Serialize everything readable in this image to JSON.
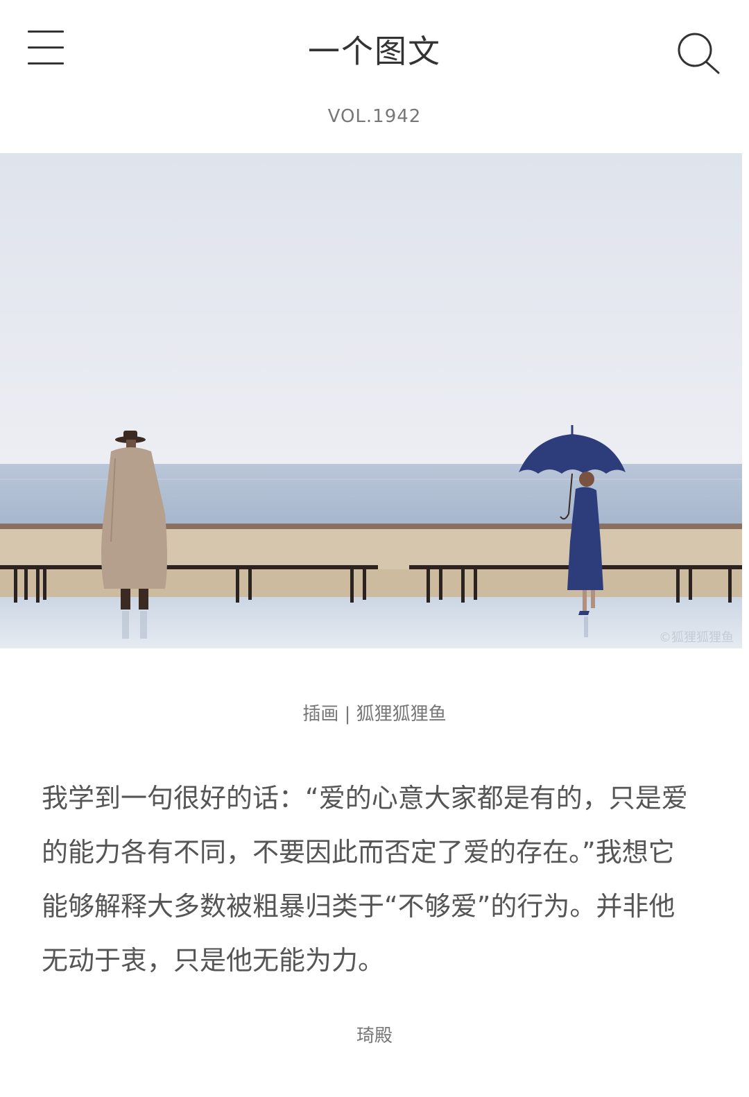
{
  "header": {
    "title": "一个图文",
    "menu_icon": "hamburger-menu-icon",
    "search_icon": "search-icon"
  },
  "issue": {
    "volume": "VOL.1942"
  },
  "illustration": {
    "credit": "插画 | 狐狸狐狸鱼",
    "watermark": "©狐狸狐狸鱼",
    "colors": {
      "sky": "#e6e9f1",
      "sea": "#aebdd2",
      "promenade": "#d8c8b0",
      "umbrella": "#2d3d7c",
      "coat": "#b5a08e"
    }
  },
  "article": {
    "text": "我学到一句很好的话：“爱的心意大家都是有的，只是爱的能力各有不同，不要因此而否定了爱的存在。”我想它能够解释大多数被粗暴归类于“不够爱”的行为。并非他无动于衷，只是他无能为力。",
    "author": "琦殿"
  }
}
